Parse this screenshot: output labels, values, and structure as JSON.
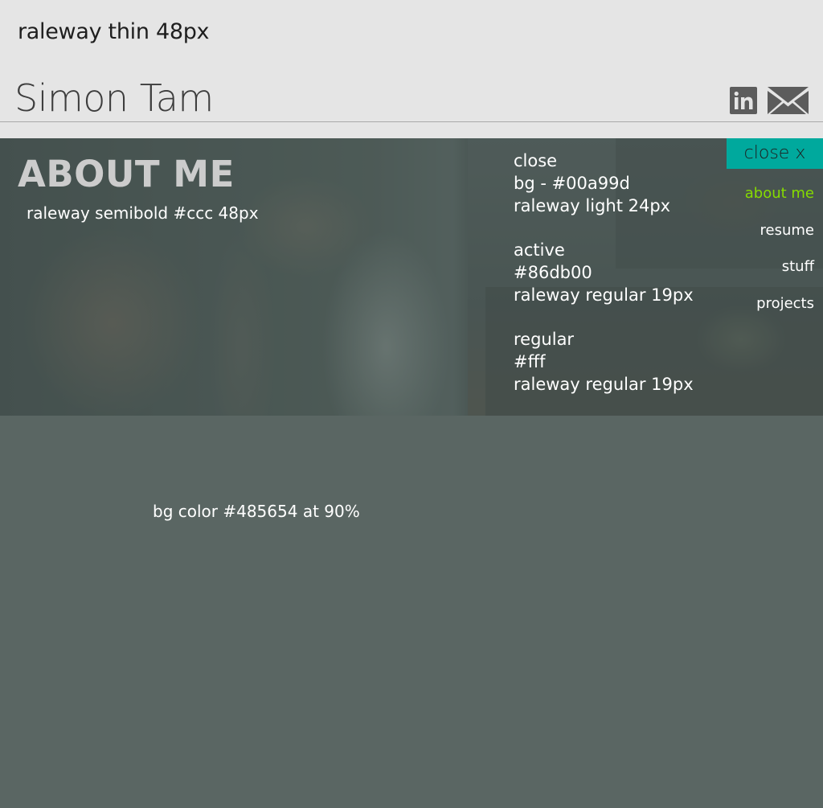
{
  "header": {
    "spec_note": "raleway thin 48px",
    "site_name": "Simon Tam",
    "social": [
      {
        "icon": "linkedin-icon",
        "glyph": "in"
      },
      {
        "icon": "mail-icon"
      }
    ]
  },
  "hero": {
    "title": "ABOUT ME",
    "title_spec_note": "raleway semibold #ccc 48px",
    "spec_blocks": [
      {
        "lines": [
          "close",
          "bg - #00a99d",
          "raleway light 24px"
        ]
      },
      {
        "lines": [
          "active",
          "#86db00",
          "raleway regular 19px"
        ]
      },
      {
        "lines": [
          "regular",
          "#fff",
          "raleway regular 19px"
        ]
      }
    ]
  },
  "nav": {
    "close_label": "close x",
    "items": [
      {
        "label": "about me",
        "active": true
      },
      {
        "label": "resume",
        "active": false
      },
      {
        "label": "stuff",
        "active": false
      },
      {
        "label": "projects",
        "active": false
      }
    ]
  },
  "body_note": "bg color #485654 at 90%",
  "colors": {
    "close_bg": "#00a99d",
    "active": "#86db00",
    "regular": "#ffffff",
    "title": "#cccccc",
    "page_bg": "#485654"
  }
}
